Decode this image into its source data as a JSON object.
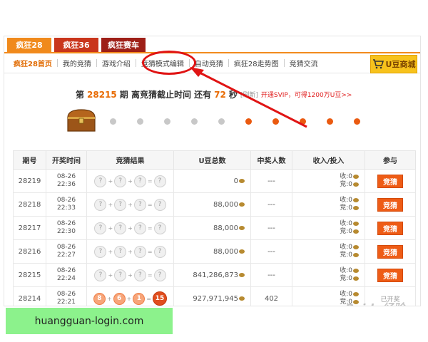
{
  "top_tabs": [
    "疯狂28",
    "疯狂36",
    "疯狂赛车"
  ],
  "nav": [
    "疯狂28首页",
    "我的竞猜",
    "游戏介绍",
    "竞猜模式编辑",
    "自动竞猜",
    "疯狂28走势图",
    "竞猜交流"
  ],
  "mall_label": "U豆商城",
  "countdown": {
    "prefix": "第",
    "period": "28215",
    "period_suffix": "期 离竞猜截止时间 还有",
    "seconds": "72",
    "seconds_suffix": "秒",
    "refresh": "[刷新]",
    "svip": "开通SVIP，可得1200万U豆>>"
  },
  "progress": {
    "total": 10,
    "filled_from": 5
  },
  "table": {
    "headers": [
      "期号",
      "开奖时间",
      "竞猜结果",
      "U豆总数",
      "中奖人数",
      "收入/投入",
      "参与"
    ],
    "io_income_label": "收:",
    "io_spend_label": "竞:",
    "rows": [
      {
        "period": "28219",
        "date": "08-26",
        "time": "22:36",
        "balls": [
          "?",
          "?",
          "?",
          "?"
        ],
        "total": "0",
        "winners": "---",
        "income": "0",
        "spend": "0",
        "action": "竞猜"
      },
      {
        "period": "28218",
        "date": "08-26",
        "time": "22:33",
        "balls": [
          "?",
          "?",
          "?",
          "?"
        ],
        "total": "88,000",
        "winners": "---",
        "income": "0",
        "spend": "0",
        "action": "竞猜"
      },
      {
        "period": "28217",
        "date": "08-26",
        "time": "22:30",
        "balls": [
          "?",
          "?",
          "?",
          "?"
        ],
        "total": "88,000",
        "winners": "---",
        "income": "0",
        "spend": "0",
        "action": "竞猜"
      },
      {
        "period": "28216",
        "date": "08-26",
        "time": "22:27",
        "balls": [
          "?",
          "?",
          "?",
          "?"
        ],
        "total": "88,000",
        "winners": "---",
        "income": "0",
        "spend": "0",
        "action": "竞猜"
      },
      {
        "period": "28215",
        "date": "08-26",
        "time": "22:24",
        "balls": [
          "?",
          "?",
          "?",
          "?"
        ],
        "total": "841,286,873",
        "winners": "---",
        "income": "0",
        "spend": "0",
        "action": "竞猜"
      },
      {
        "period": "28214",
        "date": "08-26",
        "time": "22:21",
        "balls": [
          "8",
          "6",
          "1",
          "15"
        ],
        "total": "927,971,945",
        "winners": "402",
        "income": "0",
        "spend": "0",
        "action": "已开奖"
      }
    ]
  },
  "watermark": "Baidu经验",
  "footer_text": "huangguan-login.com"
}
